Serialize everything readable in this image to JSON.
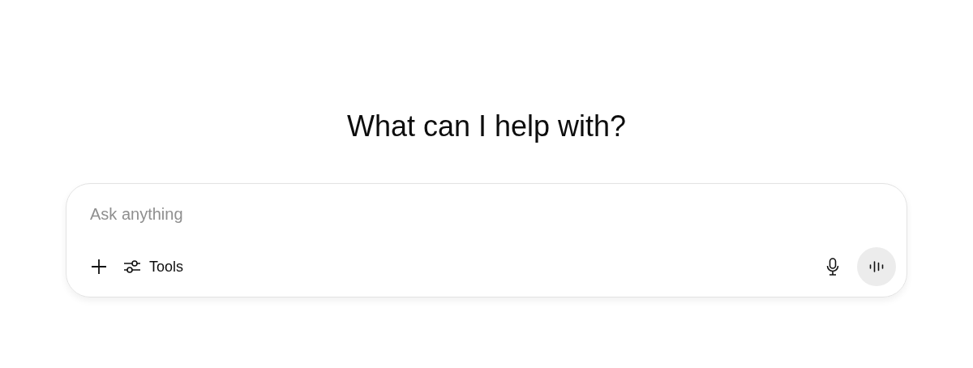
{
  "heading": "What can I help with?",
  "composer": {
    "placeholder": "Ask anything",
    "tools_label": "Tools"
  }
}
